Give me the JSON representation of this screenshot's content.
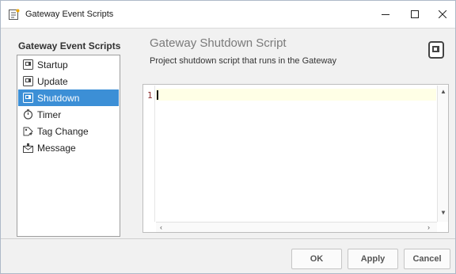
{
  "window": {
    "title": "Gateway Event Scripts"
  },
  "sidebar": {
    "heading": "Gateway Event Scripts",
    "items": [
      {
        "label": "Startup",
        "icon": "script-icon"
      },
      {
        "label": "Update",
        "icon": "script-icon"
      },
      {
        "label": "Shutdown",
        "icon": "script-icon",
        "selected": true
      },
      {
        "label": "Timer",
        "icon": "timer-icon"
      },
      {
        "label": "Tag Change",
        "icon": "tag-change-icon"
      },
      {
        "label": "Message",
        "icon": "message-icon"
      }
    ]
  },
  "main": {
    "title": "Gateway Shutdown Script",
    "description": "Project shutdown script that runs in the Gateway",
    "editor": {
      "line_number": "1",
      "content": ""
    }
  },
  "footer": {
    "ok_label": "OK",
    "apply_label": "Apply",
    "cancel_label": "Cancel"
  },
  "colors": {
    "selection": "#3c8fd6",
    "current_line": "#ffffe6",
    "line_number": "#8b2b2b"
  }
}
